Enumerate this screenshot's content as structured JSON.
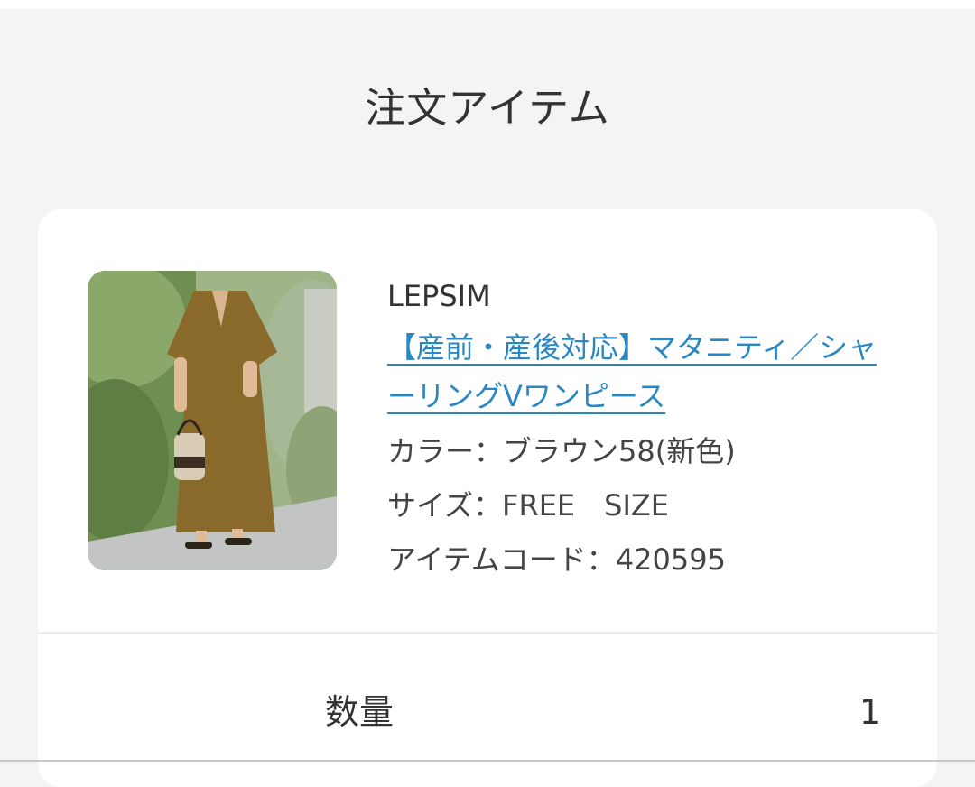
{
  "section": {
    "title": "注文アイテム"
  },
  "item": {
    "brand": "LEPSIM",
    "product_name": "【産前・産後対応】マタニティ／シャーリングVワンピース",
    "color_label": "カラー：",
    "color_value": "ブラウン58(新色)",
    "size_label": "サイズ：",
    "size_value": "FREE　SIZE",
    "code_label": "アイテムコード：",
    "code_value": "420595",
    "image_icon": "product-photo"
  },
  "quantity": {
    "label": "数量",
    "value": "1"
  },
  "colors": {
    "background": "#f4f4f4",
    "card": "#ffffff",
    "link": "#2a87c2",
    "text": "#333333"
  }
}
